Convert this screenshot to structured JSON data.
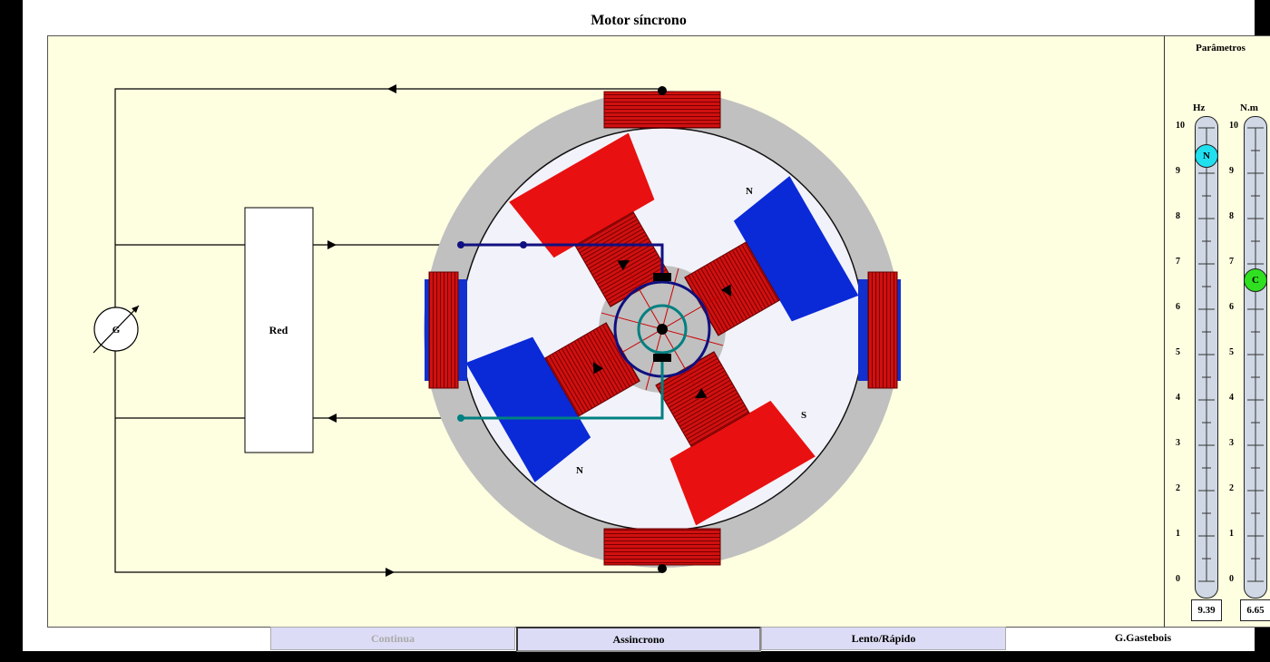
{
  "title": "Motor  síncrono",
  "diagram": {
    "generator_label": "G",
    "network_label": "Red",
    "poles": [
      "N",
      "N",
      "S"
    ]
  },
  "params": {
    "title": "Parâmetros",
    "freq_unit": "Hz",
    "torque_unit": "N.m",
    "ticks": [
      "10",
      "9",
      "8",
      "7",
      "6",
      "5",
      "4",
      "3",
      "2",
      "1",
      "0"
    ],
    "freq_knob_label": "N",
    "torque_knob_label": "C",
    "freq_value": "9.39",
    "torque_value": "6.65",
    "freq_level": 9.39,
    "torque_level": 6.65,
    "max": 10
  },
  "buttons": {
    "continua": "Continua",
    "assincrono": "Assincrono",
    "lento": "Lento/Rápido"
  },
  "credit": "G.Gastebois"
}
